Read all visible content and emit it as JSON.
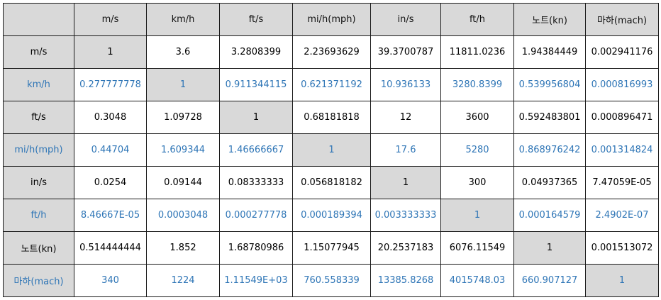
{
  "table": {
    "headers": [
      "m/s",
      "km/h",
      "ft/s",
      "mi/h(mph)",
      "in/s",
      "ft/h",
      "노트(kn)",
      "마하(mach)"
    ],
    "rows": [
      {
        "label": "m/s",
        "cells": [
          "1",
          "3.6",
          "3.2808399",
          "2.23693629",
          "39.3700787",
          "11811.0236",
          "1.94384449",
          "0.002941176"
        ]
      },
      {
        "label": "km/h",
        "cells": [
          "0.277777778",
          "1",
          "0.911344115",
          "0.621371192",
          "10.936133",
          "3280.8399",
          "0.539956804",
          "0.000816993"
        ]
      },
      {
        "label": "ft/s",
        "cells": [
          "0.3048",
          "1.09728",
          "1",
          "0.68181818",
          "12",
          "3600",
          "0.592483801",
          "0.000896471"
        ]
      },
      {
        "label": "mi/h(mph)",
        "cells": [
          "0.44704",
          "1.609344",
          "1.46666667",
          "1",
          "17.6",
          "5280",
          "0.868976242",
          "0.001314824"
        ]
      },
      {
        "label": "in/s",
        "cells": [
          "0.0254",
          "0.09144",
          "0.08333333",
          "0.056818182",
          "1",
          "300",
          "0.04937365",
          "7.47059E-05"
        ]
      },
      {
        "label": "ft/h",
        "cells": [
          "8.46667E-05",
          "0.0003048",
          "0.000277778",
          "0.000189394",
          "0.003333333",
          "1",
          "0.000164579",
          "2.4902E-07"
        ]
      },
      {
        "label": "노트(kn)",
        "cells": [
          "0.514444444",
          "1.852",
          "1.68780986",
          "1.15077945",
          "20.2537183",
          "6076.11549",
          "1",
          "0.001513072"
        ]
      },
      {
        "label": "마하(mach)",
        "cells": [
          "340",
          "1224",
          "1.11549E+03",
          "760.558339",
          "13385.8268",
          "4015748.03",
          "660.907127",
          "1"
        ]
      }
    ]
  },
  "colors": {
    "header_bg": "#d9d9d9",
    "diagonal_bg": "#d9d9d9",
    "blue_text": "#2e75b6",
    "black_text": "#000000",
    "border": "#1a1a1a"
  }
}
